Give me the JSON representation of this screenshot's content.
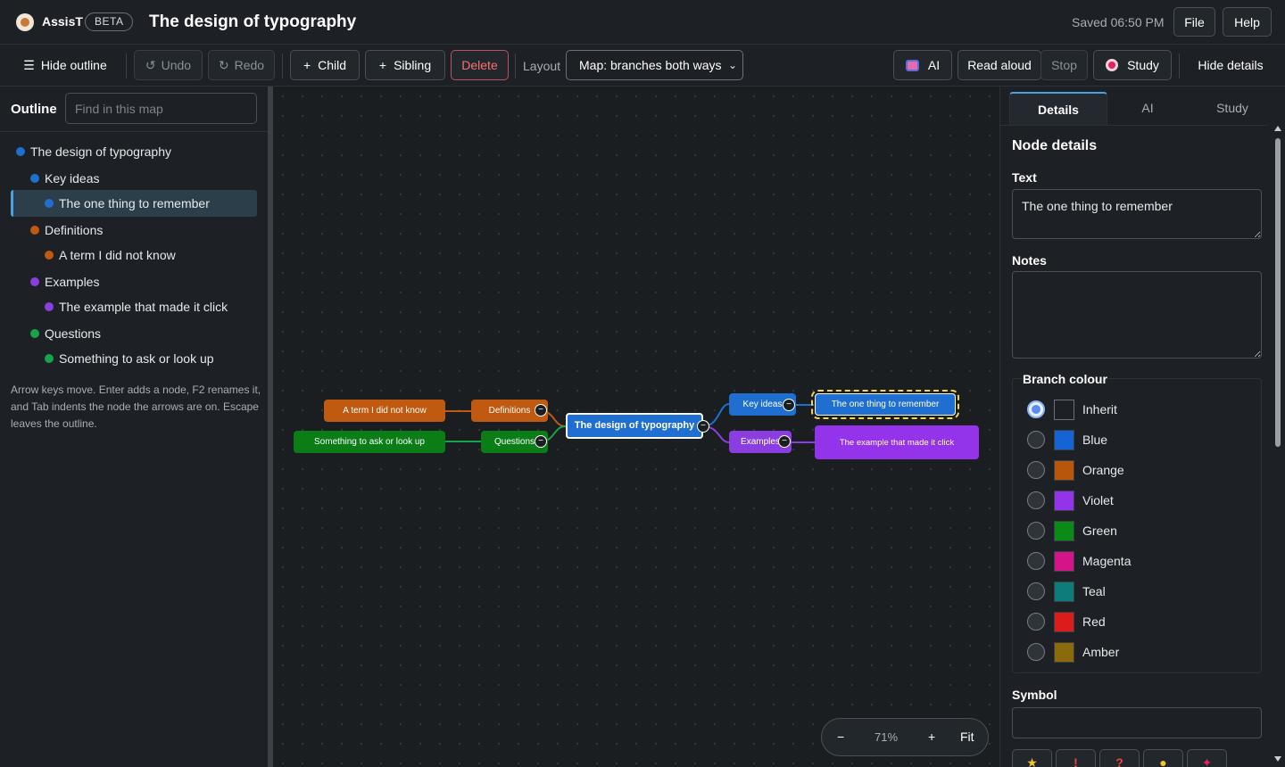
{
  "app": {
    "name": "AssisT",
    "badge": "BETA",
    "doc_title": "The design of typography",
    "saved": "Saved 06:50 PM",
    "file_label": "File",
    "help_label": "Help"
  },
  "toolbar": {
    "hide_outline": "Hide outline",
    "undo": "Undo",
    "redo": "Redo",
    "child": "Child",
    "sibling": "Sibling",
    "delete": "Delete",
    "layout_label": "Layout",
    "layout_value": "Map: branches both ways",
    "ai": "AI",
    "read_aloud": "Read aloud",
    "stop": "Stop",
    "study": "Study",
    "hide_details": "Hide details"
  },
  "outline": {
    "title": "Outline",
    "find_placeholder": "Find in this map",
    "items": [
      {
        "label": "The design of typography",
        "color": "#1f6fd1",
        "depth": 0
      },
      {
        "label": "Key ideas",
        "color": "#1f6fd1",
        "depth": 1
      },
      {
        "label": "The one thing to remember",
        "color": "#1f6fd1",
        "depth": 2,
        "selected": true
      },
      {
        "label": "Definitions",
        "color": "#c05a10",
        "depth": 1
      },
      {
        "label": "A term I did not know",
        "color": "#c05a10",
        "depth": 2
      },
      {
        "label": "Examples",
        "color": "#8a3ee0",
        "depth": 1
      },
      {
        "label": "The example that made it click",
        "color": "#8a3ee0",
        "depth": 2
      },
      {
        "label": "Questions",
        "color": "#16a34a",
        "depth": 1
      },
      {
        "label": "Something to ask or look up",
        "color": "#16a34a",
        "depth": 2
      }
    ],
    "help": "Arrow keys move. Enter adds a node, F2 renames it, and Tab indents the node the arrows are on. Escape leaves the outline."
  },
  "map": {
    "root": "The design of typography",
    "key_ideas": "Key ideas",
    "one_thing": "The one thing to remember",
    "examples": "Examples",
    "example_click": "The example that made it click",
    "definitions": "Definitions",
    "term": "A term I did not know",
    "questions": "Questions",
    "something": "Something to ask or look up",
    "toggle": "−"
  },
  "zoom": {
    "minus": "−",
    "value": "71%",
    "plus": "+",
    "fit": "Fit"
  },
  "details": {
    "tabs": [
      "Details",
      "AI",
      "Study"
    ],
    "heading": "Node details",
    "text_label": "Text",
    "text_value": "The one thing to remember",
    "notes_label": "Notes",
    "notes_value": "",
    "branch_colour_label": "Branch colour",
    "colours": [
      {
        "name": "Inherit",
        "hex": "#1d2125",
        "selected": true
      },
      {
        "name": "Blue",
        "hex": "#1464d6"
      },
      {
        "name": "Orange",
        "hex": "#b8570c"
      },
      {
        "name": "Violet",
        "hex": "#9333ea"
      },
      {
        "name": "Green",
        "hex": "#0a8a16"
      },
      {
        "name": "Magenta",
        "hex": "#d6148a"
      },
      {
        "name": "Teal",
        "hex": "#0f7c7c"
      },
      {
        "name": "Red",
        "hex": "#dc1b1b"
      },
      {
        "name": "Amber",
        "hex": "#8a6a0a"
      }
    ],
    "symbol_label": "Symbol",
    "symbols": [
      "star-icon",
      "exclamation-icon",
      "question-icon",
      "lightbulb-icon",
      "pin-icon"
    ]
  },
  "colors": {
    "accent": "#4aa3df",
    "blue": "#1f6fd1",
    "orange": "#c05a10",
    "violet": "#8a3ee0",
    "green": "#0a7d16"
  }
}
